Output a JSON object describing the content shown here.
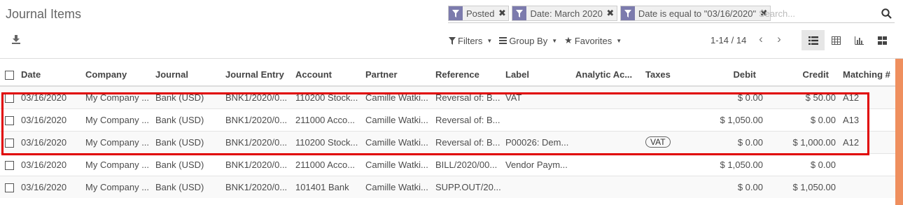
{
  "header": {
    "title": "Journal Items",
    "download_icon": "download-icon"
  },
  "search": {
    "facets": [
      {
        "label": "Posted",
        "icon": "filter-icon"
      },
      {
        "label": "Date: March 2020",
        "icon": "filter-icon"
      },
      {
        "label": "Date is equal to \"03/16/2020\"",
        "icon": "filter-icon"
      }
    ],
    "placeholder": "Search...",
    "search_icon": "search-icon"
  },
  "toolbar": {
    "filters_label": "Filters",
    "groupby_label": "Group By",
    "favorites_label": "Favorites"
  },
  "pager": {
    "value": "1-14 / 14"
  },
  "views": {
    "items": [
      "list-view-icon",
      "pivot-view-icon",
      "graph-view-icon",
      "kanban-view-icon"
    ],
    "active": "list-view-icon"
  },
  "colors": {
    "facet_icon_bg": "#7c7bad",
    "highlight": "#e00000",
    "scrollbar": "#ef8f5e"
  },
  "table": {
    "columns": [
      "Date",
      "Company",
      "Journal",
      "Journal Entry",
      "Account",
      "Partner",
      "Reference",
      "Label",
      "Analytic Ac...",
      "Taxes",
      "Debit",
      "Credit",
      "Matching #"
    ],
    "rows": [
      {
        "date": "03/16/2020",
        "company": "My Company ...",
        "journal": "Bank (USD)",
        "entry": "BNK1/2020/0...",
        "account": "110200 Stock...",
        "partner": "Camille Watki...",
        "reference": "Reversal of: B...",
        "label": "VAT",
        "analytic": "",
        "taxes": "",
        "debit": "$ 0.00",
        "credit": "$ 50.00",
        "matching": "A12"
      },
      {
        "date": "03/16/2020",
        "company": "My Company ...",
        "journal": "Bank (USD)",
        "entry": "BNK1/2020/0...",
        "account": "211000 Acco...",
        "partner": "Camille Watki...",
        "reference": "Reversal of: B...",
        "label": "",
        "analytic": "",
        "taxes": "",
        "debit": "$ 1,050.00",
        "credit": "$ 0.00",
        "matching": "A13"
      },
      {
        "date": "03/16/2020",
        "company": "My Company ...",
        "journal": "Bank (USD)",
        "entry": "BNK1/2020/0...",
        "account": "110200 Stock...",
        "partner": "Camille Watki...",
        "reference": "Reversal of: B...",
        "label": "P00026: Dem...",
        "analytic": "",
        "taxes": "VAT",
        "debit": "$ 0.00",
        "credit": "$ 1,000.00",
        "matching": "A12"
      },
      {
        "date": "03/16/2020",
        "company": "My Company ...",
        "journal": "Bank (USD)",
        "entry": "BNK1/2020/0...",
        "account": "211000 Acco...",
        "partner": "Camille Watki...",
        "reference": "BILL/2020/00...",
        "label": "Vendor Paym...",
        "analytic": "",
        "taxes": "",
        "debit": "$ 1,050.00",
        "credit": "$ 0.00",
        "matching": ""
      },
      {
        "date": "03/16/2020",
        "company": "My Company ...",
        "journal": "Bank (USD)",
        "entry": "BNK1/2020/0...",
        "account": "101401 Bank",
        "partner": "Camille Watki...",
        "reference": "SUPP.OUT/20...",
        "label": "",
        "analytic": "",
        "taxes": "",
        "debit": "$ 0.00",
        "credit": "$ 1,050.00",
        "matching": ""
      }
    ]
  }
}
